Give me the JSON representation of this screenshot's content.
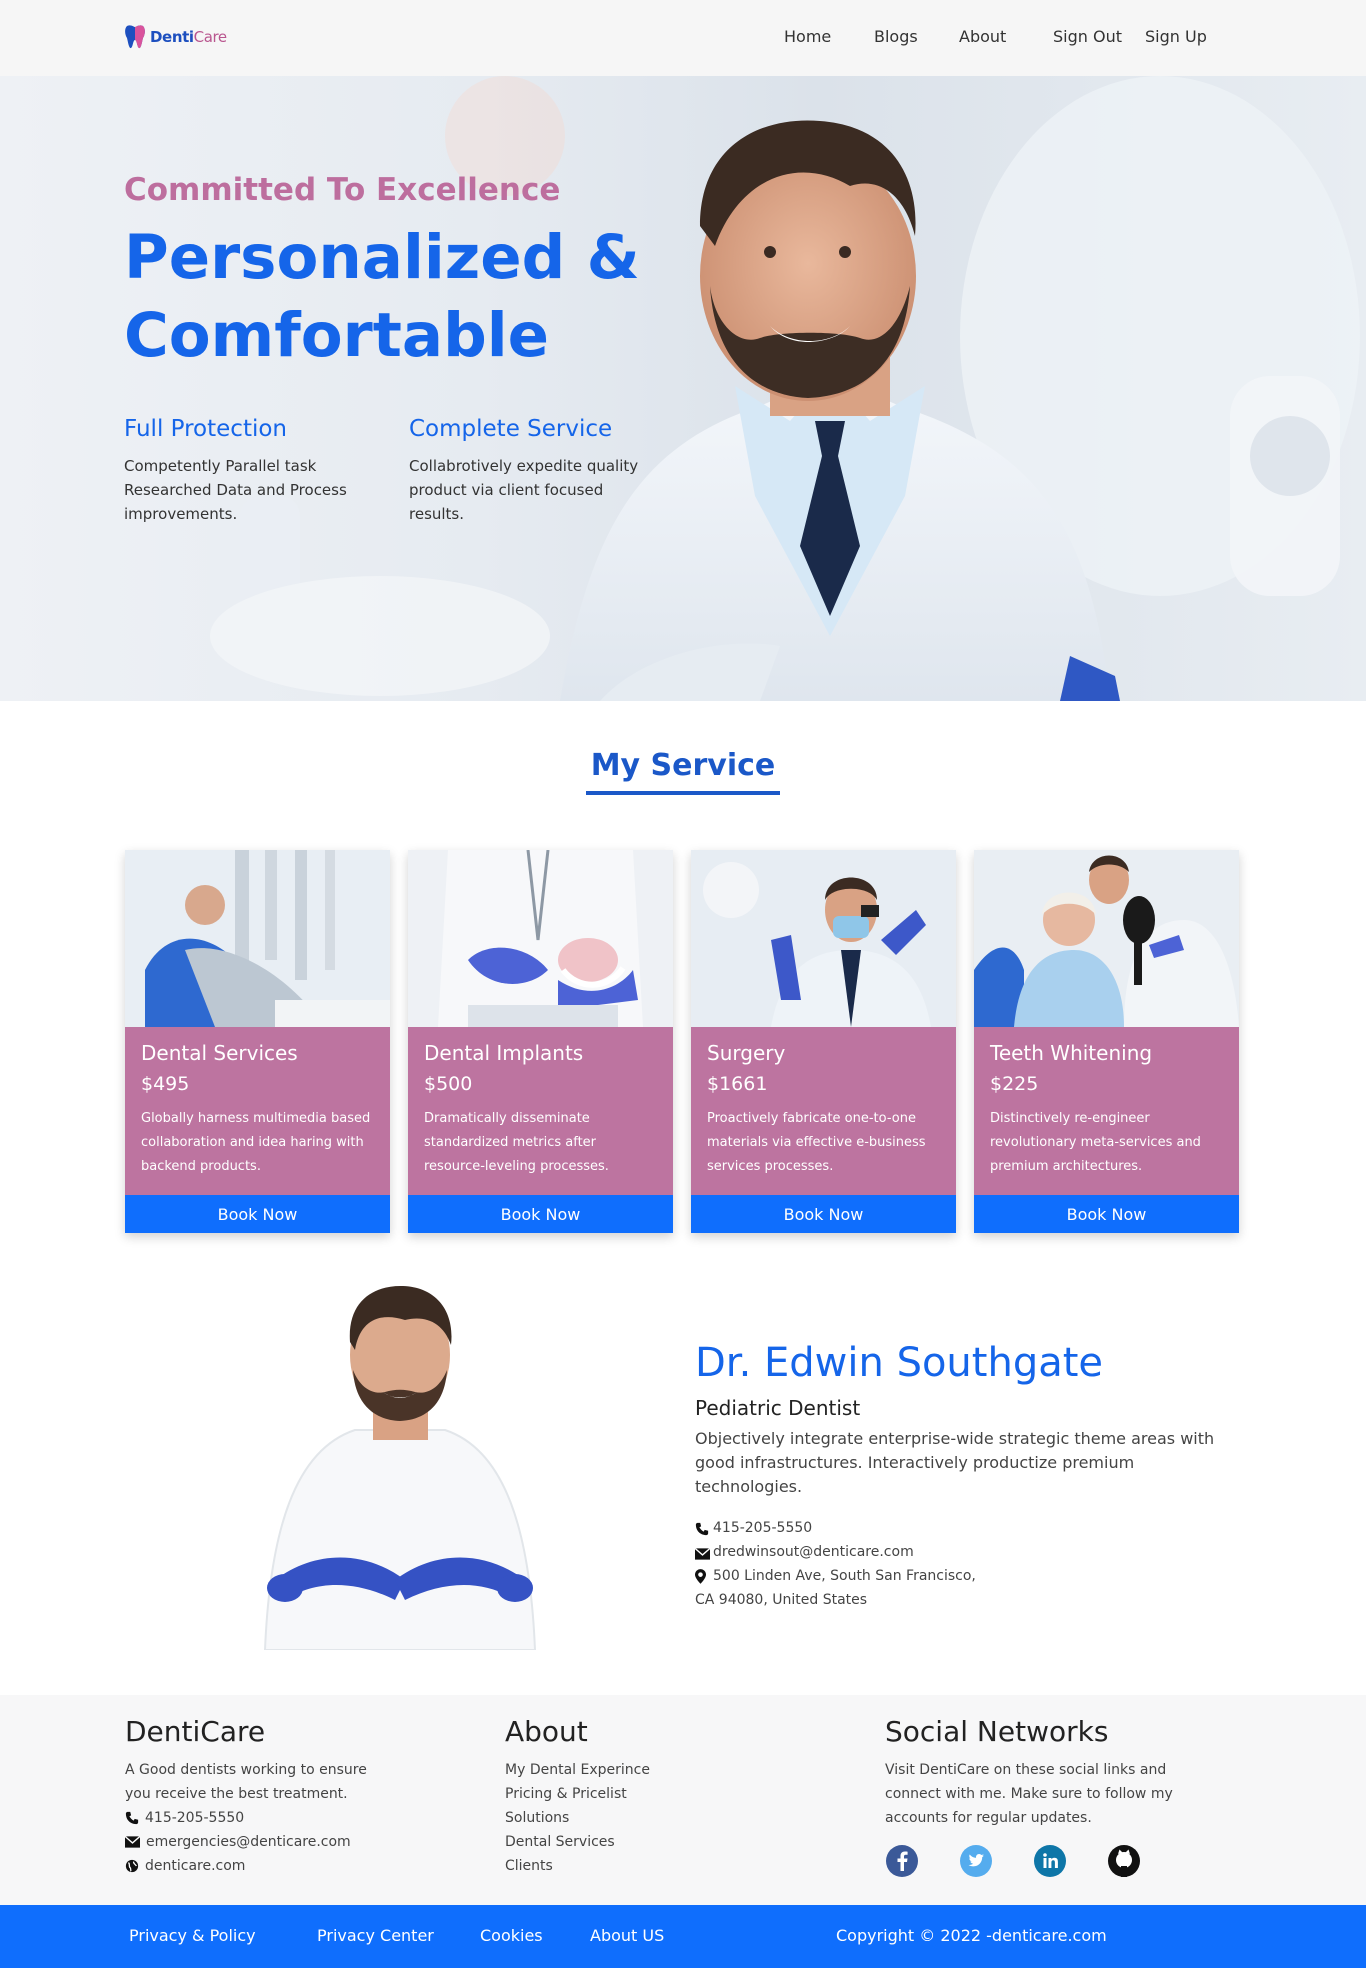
{
  "brand": {
    "name_part1": "Denti",
    "name_part2": "Care"
  },
  "nav": {
    "home": "Home",
    "blogs": "Blogs",
    "about": "About",
    "sign_out": "Sign Out",
    "sign_up": "Sign Up"
  },
  "hero": {
    "eyebrow": "Committed To Excellence",
    "headline": "Personalized & Comfortable",
    "features": [
      {
        "title": "Full Protection",
        "text": "Competently Parallel task Researched Data and Process improvements."
      },
      {
        "title": "Complete Service",
        "text": "Collabrotively expedite quality product via client focused results."
      }
    ]
  },
  "services": {
    "title": "My Service",
    "cards": [
      {
        "title": "Dental Services",
        "price": "$495",
        "text": "Globally harness multimedia based collaboration and idea haring with backend products.",
        "button": "Book Now"
      },
      {
        "title": "Dental Implants",
        "price": "$500",
        "text": "Dramatically disseminate standardized metrics after resource-leveling processes.",
        "button": "Book Now"
      },
      {
        "title": "Surgery",
        "price": "$1661",
        "text": "Proactively fabricate one-to-one materials via effective e-business services processes.",
        "button": "Book Now"
      },
      {
        "title": "Teeth Whitening",
        "price": "$225",
        "text": "Distinctively re-engineer revolutionary meta-services and premium architectures.",
        "button": "Book Now"
      }
    ]
  },
  "doctor": {
    "name": "Dr. Edwin Southgate",
    "title": "Pediatric Dentist",
    "description": "Objectively integrate enterprise-wide strategic theme areas with good infrastructures. Interactively productize premium technologies.",
    "phone": "415-205-5550",
    "email": "dredwinsout@denticare.com",
    "address_line1": "500 Linden Ave, South San Francisco,",
    "address_line2": "CA 94080, United States"
  },
  "footer": {
    "brand": {
      "title": "DentiCare",
      "text": "A Good dentists working to ensure you receive the best treatment.",
      "phone": "415-205-5550",
      "email": "emergencies@denticare.com",
      "website": "denticare.com"
    },
    "about": {
      "title": "About",
      "links": [
        "My Dental Experince",
        "Pricing & Pricelist",
        "Solutions",
        "Dental Services",
        "Clients"
      ]
    },
    "social": {
      "title": "Social Networks",
      "text": "Visit DentiCare on these social links and connect with me. Make sure to follow my accounts for regular updates.",
      "icons": [
        "facebook-icon",
        "twitter-icon",
        "linkedin-icon",
        "github-icon"
      ]
    }
  },
  "bottom_bar": {
    "links": [
      "Privacy & Policy",
      "Privacy Center",
      "Cookies",
      "About US"
    ],
    "copyright": "Copyright © 2022 -denticare.com"
  },
  "colors": {
    "primary": "#0f6efd",
    "heading_blue": "#1565e9",
    "pink": "#bd74a0",
    "eyebrow_pink": "#bd6e9e"
  }
}
